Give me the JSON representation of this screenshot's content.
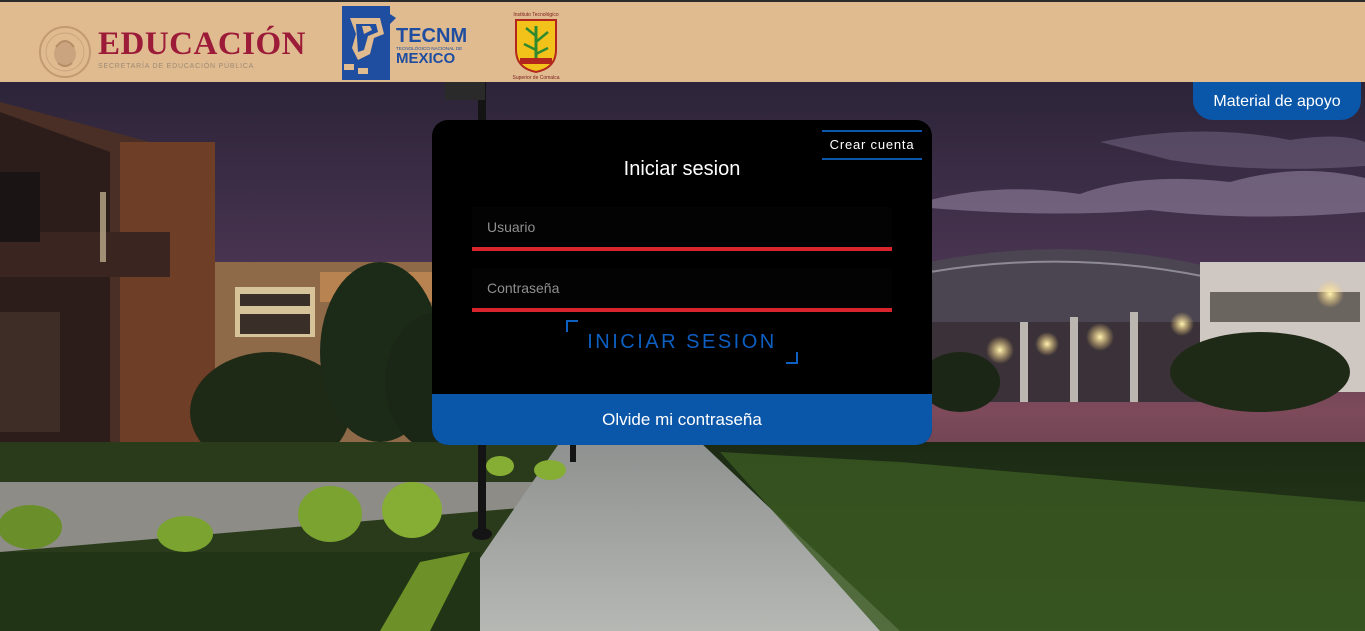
{
  "header": {
    "sep_title": "EDUCACIÓN",
    "sep_subtitle": "SECRETARÍA DE EDUCACIÓN PÚBLICA",
    "tecnm_line1": "TECNM",
    "tecnm_line2": "TECNOLÓGICO NACIONAL DE",
    "tecnm_line3": "MEXICO",
    "ito_top": "Instituto Tecnológico",
    "ito_bottom": "Superior de Comalca"
  },
  "material_button": "Material de apoyo",
  "login": {
    "create_account": "Crear cuenta",
    "title": "Iniciar sesion",
    "username_placeholder": "Usuario",
    "password_placeholder": "Contraseña",
    "submit": "INICIAR SESION",
    "forgot": "Olvide mi contraseña"
  },
  "colors": {
    "header_bg": "#e0bb8f",
    "brand_red": "#9b1b39",
    "accent_blue": "#0a56a8",
    "underline_red": "#d9232d"
  }
}
